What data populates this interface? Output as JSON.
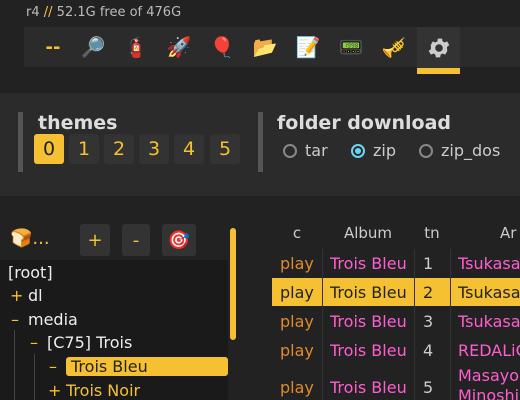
{
  "status": {
    "host": "r4",
    "sep": "//",
    "free": "52.1G free of 476G"
  },
  "toolbar": {
    "items": [
      {
        "name": "dashes",
        "glyph": "--"
      },
      {
        "name": "search-icon",
        "glyph": "🔎"
      },
      {
        "name": "fire-extinguisher-icon",
        "glyph": "🧯"
      },
      {
        "name": "rocket-icon",
        "glyph": "🚀"
      },
      {
        "name": "balloon-icon",
        "glyph": "🎈"
      },
      {
        "name": "folder-icon",
        "glyph": "📂"
      },
      {
        "name": "memo-icon",
        "glyph": "📝"
      },
      {
        "name": "pager-icon",
        "glyph": "📟"
      },
      {
        "name": "trumpet-icon",
        "glyph": "🎺"
      },
      {
        "name": "gear-icon",
        "glyph": "⚙️"
      }
    ],
    "active_index": 9,
    "accent": "#f5c132"
  },
  "themes": {
    "title": "themes",
    "options": [
      "0",
      "1",
      "2",
      "3",
      "4",
      "5"
    ],
    "selected": "0"
  },
  "folder_download": {
    "title": "folder download",
    "options": [
      "tar",
      "zip",
      "zip_dos"
    ],
    "selected": "zip"
  },
  "tree_header": {
    "bread": "🍞...",
    "plus": "+",
    "minus": "-",
    "target": "🎯"
  },
  "tree": [
    {
      "expander": "",
      "label": "[root]"
    },
    {
      "expander": "+",
      "label": "dl"
    },
    {
      "expander": "–",
      "label": "media"
    },
    {
      "expander": "–",
      "label": "[C75] Trois"
    },
    {
      "expander": "–",
      "label": "Trois Bleu"
    },
    {
      "expander": "+",
      "label": "Trois Noir"
    }
  ],
  "files": {
    "columns": [
      "c",
      "Album",
      "tn",
      "Ar"
    ],
    "rows": [
      {
        "c": "play",
        "album": "Trois Bleu",
        "tn": "1",
        "artist": "Tsukasa"
      },
      {
        "c": "play",
        "album": "Trois Bleu",
        "tn": "2",
        "artist": "Tsukasa"
      },
      {
        "c": "play",
        "album": "Trois Bleu",
        "tn": "3",
        "artist": "Tsukasa"
      },
      {
        "c": "play",
        "album": "Trois Bleu",
        "tn": "4",
        "artist": "REDALiC"
      },
      {
        "c": "play",
        "album": "Trois Bleu",
        "tn": "5",
        "artist": "Masayo",
        "artist2": "Minoshi"
      }
    ]
  }
}
